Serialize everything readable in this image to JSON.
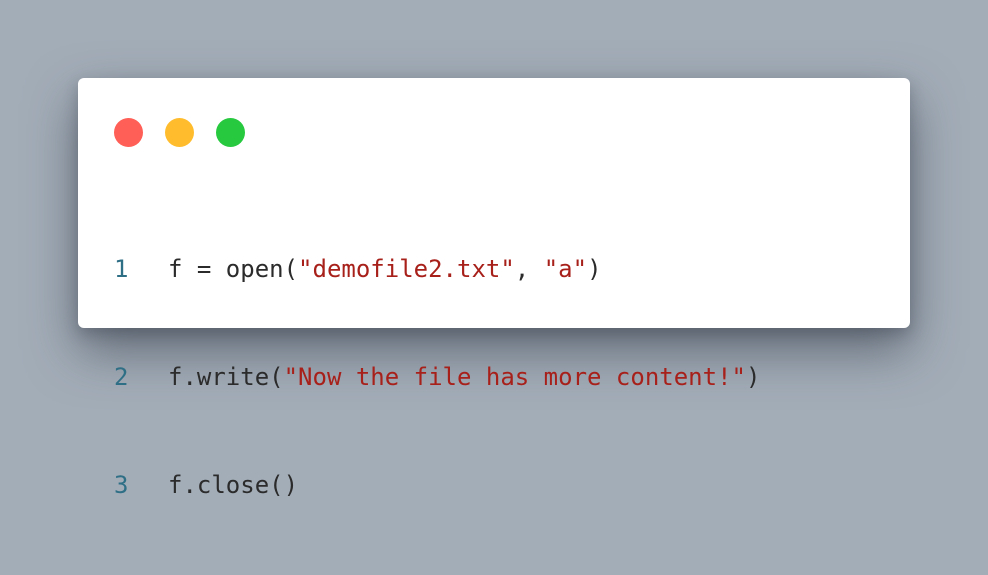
{
  "window": {
    "controls": {
      "close": {
        "color": "#ff5f56"
      },
      "minimize": {
        "color": "#ffbd2e"
      },
      "maximize": {
        "color": "#27c93f"
      }
    }
  },
  "code": {
    "lines": [
      {
        "number": "1",
        "tokens": [
          {
            "type": "plain",
            "text": "f = open("
          },
          {
            "type": "string",
            "text": "\"demofile2.txt\""
          },
          {
            "type": "plain",
            "text": ", "
          },
          {
            "type": "string",
            "text": "\"a\""
          },
          {
            "type": "plain",
            "text": ")"
          }
        ]
      },
      {
        "number": "2",
        "tokens": [
          {
            "type": "plain",
            "text": "f.write("
          },
          {
            "type": "string",
            "text": "\"Now the file has more content!\""
          },
          {
            "type": "plain",
            "text": ")"
          }
        ]
      },
      {
        "number": "3",
        "tokens": [
          {
            "type": "plain",
            "text": "f.close()"
          }
        ]
      }
    ]
  },
  "colors": {
    "background": "#a3adb8",
    "panel": "#ffffff",
    "line_number": "#2f6f86",
    "string": "#a8201a",
    "text": "#2b2b2b"
  }
}
